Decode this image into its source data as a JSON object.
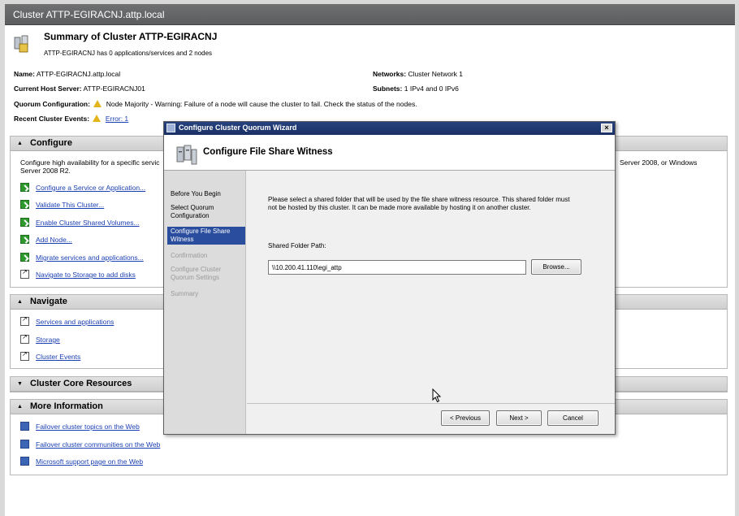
{
  "window": {
    "title": "Cluster ATTP-EGIRACNJ.attp.local"
  },
  "summary": {
    "title": "Summary of Cluster ATTP-EGIRACNJ",
    "subtitle": "ATTP-EGIRACNJ has 0 applications/services and 2 nodes",
    "name_label": "Name:",
    "name_value": "ATTP-EGIRACNJ.attp.local",
    "host_label": "Current Host Server:",
    "host_value": "ATTP-EGIRACNJ01",
    "quorum_label": "Quorum Configuration:",
    "quorum_value": "Node Majority - Warning: Failure of a node will cause the cluster to fail. Check the status of the nodes.",
    "events_label": "Recent Cluster Events:",
    "events_value": "Error: 1",
    "networks_label": "Networks:",
    "networks_value": "Cluster Network 1",
    "subnets_label": "Subnets:",
    "subnets_value": "1 IPv4 and 0 IPv6"
  },
  "configure": {
    "header": "Configure",
    "desc_left": "Configure high availability for a specific servic",
    "desc_left_2": "Server 2008 R2.",
    "desc_right": "Server 2008, or Windows",
    "items": [
      "Configure a Service or Application...",
      "Validate This Cluster...",
      "Enable Cluster Shared Volumes...",
      "Add Node...",
      "Migrate services and applications...",
      "Navigate to Storage to add disks"
    ]
  },
  "navigate": {
    "header": "Navigate",
    "items": [
      "Services and applications",
      "Storage",
      "Cluster Events"
    ]
  },
  "core": {
    "header": "Cluster Core Resources"
  },
  "more": {
    "header": "More Information",
    "items": [
      "Failover cluster topics on the Web",
      "Failover cluster communities on the Web",
      "Microsoft support page on the Web"
    ]
  },
  "dialog": {
    "title": "Configure Cluster Quorum Wizard",
    "close": "×",
    "header_title": "Configure File Share Witness",
    "steps": [
      "Before You Begin",
      "Select Quorum Configuration",
      "Configure File Share Witness",
      "Confirmation",
      "Configure Cluster Quorum Settings",
      "Summary"
    ],
    "instructions": "Please select a shared folder that will be used by the file share witness resource.  This shared folder must not be hosted by this cluster.  It can be made more available by hosting it on another cluster.",
    "path_label": "Shared Folder Path:",
    "path_value": "\\\\10.200.41.110\\egi_attp",
    "browse": "Browse...",
    "previous": "< Previous",
    "next": "Next >",
    "cancel": "Cancel"
  },
  "colors": {
    "title_bar": "#5c5d5f",
    "dialog_title": "#1a2f66",
    "active_step": "#2a4d9e",
    "link": "#1a3fb3",
    "warning": "#e3b51a"
  }
}
